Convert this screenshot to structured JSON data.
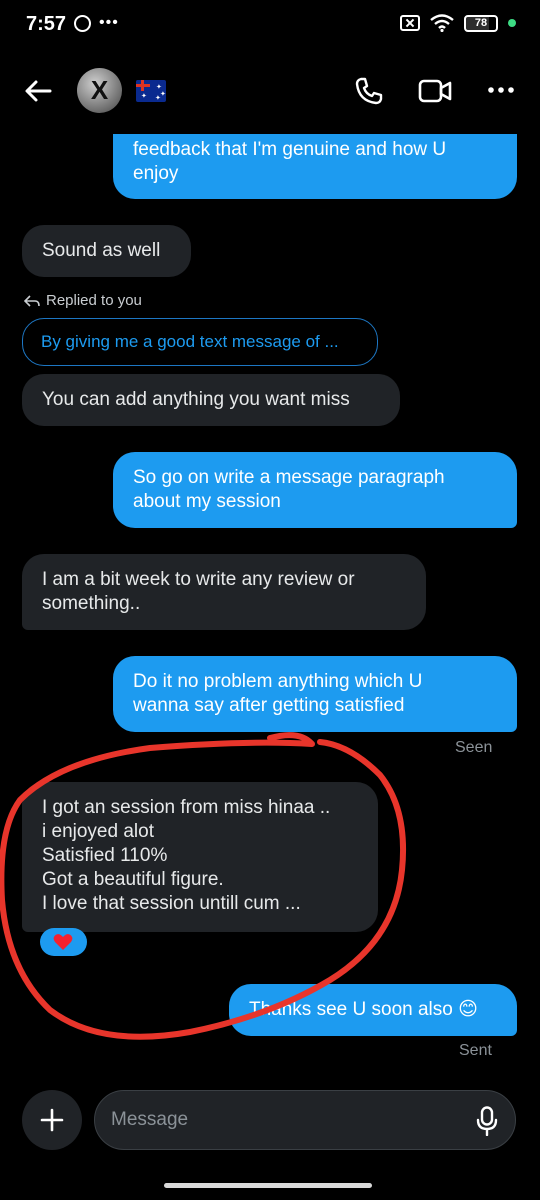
{
  "status_bar": {
    "time": "7:57",
    "battery": "78",
    "accent_green": "#3ddc84"
  },
  "header": {
    "avatar_letter": "X",
    "flag": "australia-flag-icon",
    "icons": [
      "back-arrow-icon",
      "phone-icon",
      "video-icon",
      "more-icon"
    ]
  },
  "colors": {
    "outgoing_bubble": "#1d9bf0",
    "incoming_bubble": "#202327",
    "background": "#000000",
    "scribble": "#e8352b"
  },
  "messages": [
    {
      "direction": "out",
      "text_lines": [
        "feedback that I'm genuine and how U",
        "enjoy"
      ]
    },
    {
      "direction": "in",
      "text_lines": [
        "Sound as well"
      ]
    },
    {
      "direction": "in",
      "replied_label": "Replied to you",
      "reply_quote": "By giving me a good text message of ...",
      "text_lines": [
        "You can add anything you want miss"
      ]
    },
    {
      "direction": "out",
      "text_lines": [
        "So go on write a message paragraph",
        "about my session"
      ]
    },
    {
      "direction": "in",
      "text_lines": [
        "I am a bit week to write any review or",
        "something.."
      ]
    },
    {
      "direction": "out",
      "text_lines": [
        "Do it no problem anything which U",
        "wanna say after getting satisfied"
      ],
      "status": "Seen"
    },
    {
      "direction": "in",
      "text_lines": [
        "I got an session from miss hinaa ..",
        "i enjoyed alot",
        "Satisfied 110%",
        "Got a beautiful figure.",
        "I love that session untill cum ..."
      ],
      "reaction": "heart-icon"
    },
    {
      "direction": "out",
      "text_lines": [
        "Thanks see U soon also 😊"
      ],
      "status": "Sent"
    }
  ],
  "composer": {
    "placeholder": "Message"
  }
}
